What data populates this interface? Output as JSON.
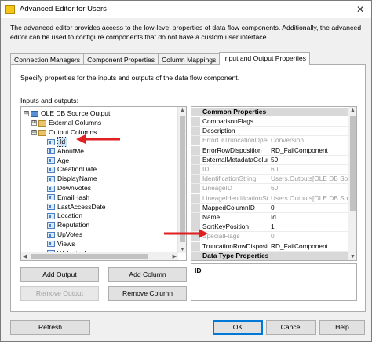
{
  "window": {
    "title": "Advanced Editor for Users",
    "close_glyph": "✕"
  },
  "description": "The advanced editor provides access to the low-level properties of data flow components. Additionally, the advanced editor can be used to configure components that do not have a custom user interface.",
  "tabs": [
    {
      "label": "Connection Managers"
    },
    {
      "label": "Component Properties"
    },
    {
      "label": "Column Mappings"
    },
    {
      "label": "Input and Output Properties"
    }
  ],
  "panel": {
    "description": "Specify properties for the inputs and outputs of the data flow component.",
    "inputs_outputs_label": "Inputs and outputs:"
  },
  "tree": {
    "root": "OLE DB Source Output",
    "external": "External Columns",
    "output": "Output Columns",
    "columns": [
      "Id",
      "AboutMe",
      "Age",
      "CreationDate",
      "DisplayName",
      "DownVotes",
      "EmailHash",
      "LastAccessDate",
      "Location",
      "Reputation",
      "UpVotes",
      "Views",
      "WebsiteUrl"
    ],
    "expanded_glyph": "⊟",
    "collapsed_glyph": "⊞"
  },
  "buttons": {
    "add_output": "Add Output",
    "add_column": "Add Column",
    "remove_output": "Remove Output",
    "remove_column": "Remove Column",
    "refresh": "Refresh",
    "ok": "OK",
    "cancel": "Cancel",
    "help": "Help"
  },
  "properties": {
    "category_common": "Common Properties",
    "category_datatype": "Data Type Properties",
    "rows": [
      {
        "name": "ComparisonFlags",
        "value": "",
        "readonly": false
      },
      {
        "name": "Description",
        "value": "",
        "readonly": false
      },
      {
        "name": "ErrorOrTruncationOpera",
        "value": "Conversion",
        "readonly": true
      },
      {
        "name": "ErrorRowDisposition",
        "value": "RD_FailComponent",
        "readonly": false
      },
      {
        "name": "ExternalMetadataColum",
        "value": "59",
        "readonly": false
      },
      {
        "name": "ID",
        "value": "60",
        "readonly": true
      },
      {
        "name": "IdentificationString",
        "value": "Users.Outputs[OLE DB Sourc",
        "readonly": true
      },
      {
        "name": "LineageID",
        "value": "60",
        "readonly": true
      },
      {
        "name": "LineageIdentificationStr",
        "value": "Users.Outputs[OLE DB Sourc",
        "readonly": true
      },
      {
        "name": "MappedColumnID",
        "value": "0",
        "readonly": false
      },
      {
        "name": "Name",
        "value": "Id",
        "readonly": false
      },
      {
        "name": "SortKeyPosition",
        "value": "1",
        "readonly": false
      },
      {
        "name": "SpecialFlags",
        "value": "0",
        "readonly": true
      },
      {
        "name": "TruncationRowDispositi",
        "value": "RD_FailComponent",
        "readonly": false
      }
    ],
    "selected_title": "ID"
  },
  "colors": {
    "accent": "#0078d7",
    "annotation_arrow": "#e02020"
  }
}
